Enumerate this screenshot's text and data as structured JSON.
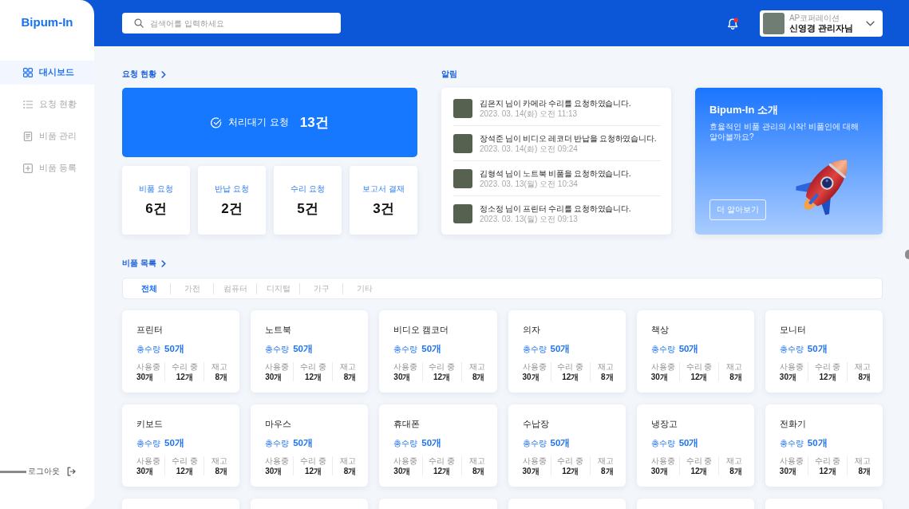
{
  "sidebar": {
    "logo": "Bipum-In",
    "items": [
      {
        "label": "대시보드",
        "selected": true
      },
      {
        "label": "요청 현황",
        "selected": false
      },
      {
        "label": "비품 관리",
        "selected": false
      },
      {
        "label": "비품 등록",
        "selected": false
      }
    ],
    "logout": "로그아웃"
  },
  "header": {
    "search": {
      "placeholder": "검색어를 입력하세요"
    },
    "has_unread": true,
    "profile": {
      "company": "AP코퍼레이션",
      "name": "신영경 관리자님"
    }
  },
  "requests": {
    "title": "요청 현황",
    "pending": {
      "label": "처리대기 요청",
      "count": "13건"
    },
    "stats": [
      {
        "label": "비품 요청",
        "count": "6건"
      },
      {
        "label": "반납 요청",
        "count": "2건"
      },
      {
        "label": "수리 요청",
        "count": "5건"
      },
      {
        "label": "보고서 결재",
        "count": "3건"
      }
    ]
  },
  "notifications": {
    "title": "알림",
    "items": [
      {
        "message": "김은지 님이 카메라 수리를 요청하였습니다.",
        "time": "2023. 03. 14(화) 오전 11:13"
      },
      {
        "message": "장석준 님이 비디오 레코더 반납을 요청하였습니다.",
        "time": "2023. 03. 14(화) 오전 09:24"
      },
      {
        "message": "김형석 님이 노트북 비품을 요청하였습니다.",
        "time": "2023. 03. 13(월) 오전 10:34"
      },
      {
        "message": "정소정 님이 프린터 수리를 요청하였습니다.",
        "time": "2023. 03. 13(월) 오전 09:13"
      }
    ]
  },
  "intro": {
    "title": "Bipum-In 소개",
    "text": "효율적인 비품 관리의 시작! 비품인에 대해 알아볼까요?",
    "button": "더 알아보기"
  },
  "inventory": {
    "title": "비품 목록",
    "tabs": [
      {
        "label": "전체",
        "selected": true
      },
      {
        "label": "가전",
        "selected": false
      },
      {
        "label": "컴퓨터",
        "selected": false
      },
      {
        "label": "디지털",
        "selected": false
      },
      {
        "label": "가구",
        "selected": false
      },
      {
        "label": "기타",
        "selected": false
      }
    ],
    "items": [
      {
        "kind": "card",
        "name": "프린터",
        "total_label": "총수량",
        "total_value": "50개",
        "stats": [
          {
            "label": "사용중",
            "value": "30개"
          },
          {
            "label": "수리 중",
            "value": "12개"
          },
          {
            "label": "재고",
            "value": "8개"
          }
        ]
      },
      {
        "kind": "card",
        "name": "노트북",
        "total_label": "총수량",
        "total_value": "50개",
        "stats": [
          {
            "label": "사용중",
            "value": "30개"
          },
          {
            "label": "수리 중",
            "value": "12개"
          },
          {
            "label": "재고",
            "value": "8개"
          }
        ]
      },
      {
        "kind": "card",
        "name": "비디오 캠코더",
        "total_label": "총수량",
        "total_value": "50개",
        "stats": [
          {
            "label": "사용중",
            "value": "30개"
          },
          {
            "label": "수리 중",
            "value": "12개"
          },
          {
            "label": "재고",
            "value": "8개"
          }
        ]
      },
      {
        "kind": "card",
        "name": "의자",
        "total_label": "총수량",
        "total_value": "50개",
        "stats": [
          {
            "label": "사용중",
            "value": "30개"
          },
          {
            "label": "수리 중",
            "value": "12개"
          },
          {
            "label": "재고",
            "value": "8개"
          }
        ]
      },
      {
        "kind": "card",
        "name": "책상",
        "total_label": "총수량",
        "total_value": "50개",
        "stats": [
          {
            "label": "사용중",
            "value": "30개"
          },
          {
            "label": "수리 중",
            "value": "12개"
          },
          {
            "label": "재고",
            "value": "8개"
          }
        ]
      },
      {
        "kind": "card",
        "name": "모니터",
        "total_label": "총수량",
        "total_value": "50개",
        "stats": [
          {
            "label": "사용중",
            "value": "30개"
          },
          {
            "label": "수리 중",
            "value": "12개"
          },
          {
            "label": "재고",
            "value": "8개"
          }
        ]
      },
      {
        "kind": "card",
        "name": "키보드",
        "total_label": "총수량",
        "total_value": "50개",
        "stats": [
          {
            "label": "사용중",
            "value": "30개"
          },
          {
            "label": "수리 중",
            "value": "12개"
          },
          {
            "label": "재고",
            "value": "8개"
          }
        ]
      },
      {
        "kind": "card",
        "name": "마우스",
        "total_label": "총수량",
        "total_value": "50개",
        "stats": [
          {
            "label": "사용중",
            "value": "30개"
          },
          {
            "label": "수리 중",
            "value": "12개"
          },
          {
            "label": "재고",
            "value": "8개"
          }
        ]
      },
      {
        "kind": "card",
        "name": "휴대폰",
        "total_label": "총수량",
        "total_value": "50개",
        "stats": [
          {
            "label": "사용중",
            "value": "30개"
          },
          {
            "label": "수리 중",
            "value": "12개"
          },
          {
            "label": "재고",
            "value": "8개"
          }
        ]
      },
      {
        "kind": "card",
        "name": "수납장",
        "total_label": "총수량",
        "total_value": "50개",
        "stats": [
          {
            "label": "사용중",
            "value": "30개"
          },
          {
            "label": "수리 중",
            "value": "12개"
          },
          {
            "label": "재고",
            "value": "8개"
          }
        ]
      },
      {
        "kind": "card",
        "name": "냉장고",
        "total_label": "총수량",
        "total_value": "50개",
        "stats": [
          {
            "label": "사용중",
            "value": "30개"
          },
          {
            "label": "수리 중",
            "value": "12개"
          },
          {
            "label": "재고",
            "value": "8개"
          }
        ]
      },
      {
        "kind": "card",
        "name": "전화기",
        "total_label": "총수량",
        "total_value": "50개",
        "stats": [
          {
            "label": "사용중",
            "value": "30개"
          },
          {
            "label": "수리 중",
            "value": "12개"
          },
          {
            "label": "재고",
            "value": "8개"
          }
        ]
      },
      {
        "kind": "partial"
      },
      {
        "kind": "partial"
      },
      {
        "kind": "partial"
      },
      {
        "kind": "partial"
      },
      {
        "kind": "partial"
      },
      {
        "kind": "partial"
      }
    ]
  }
}
